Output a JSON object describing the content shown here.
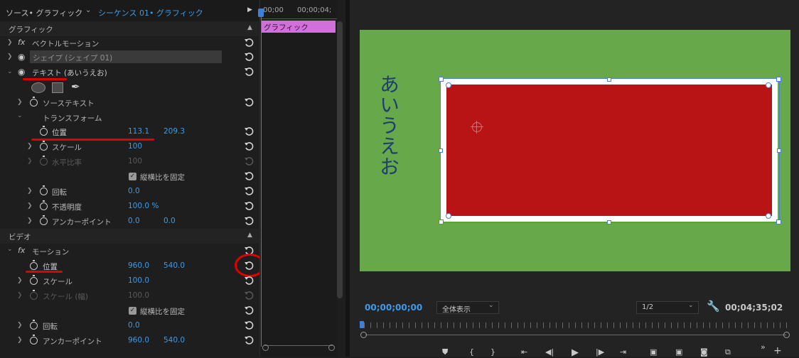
{
  "header": {
    "source_tab": "ソース• グラフィック",
    "sequence_tab": "シーケンス 01• グラフィック",
    "time_start": "00;00",
    "time_end": "00;00;04;"
  },
  "sections": {
    "graphics": "グラフィック",
    "video": "ビデオ"
  },
  "graphics": {
    "vector_motion": "ベクトルモーション",
    "shape_layer": "シェイプ (シェイプ 01)",
    "text_layer": "テキスト (あいうえお)",
    "source_text": "ソーステキスト",
    "transform": "トランスフォーム",
    "position_label": "位置",
    "position_x": "113.1",
    "position_y": "209.3",
    "scale_label": "スケール",
    "scale_value": "100",
    "scale_h_label": "水平比率",
    "scale_h_value": "100",
    "uniform_scale": "縦横比を固定",
    "rotation_label": "回転",
    "rotation_value": "0.0",
    "opacity_label": "不透明度",
    "opacity_value": "100.0 %",
    "anchor_label": "アンカーポイント",
    "anchor_x": "0.0",
    "anchor_y": "0.0"
  },
  "video": {
    "motion": "モーション",
    "position_label": "位置",
    "position_x": "960.0",
    "position_y": "540.0",
    "scale_label": "スケール",
    "scale_value": "100.0",
    "scale_w_label": "スケール (幅)",
    "scale_w_value": "100.0",
    "uniform_scale": "縦横比を固定",
    "rotation_label": "回転",
    "rotation_value": "0.0",
    "anchor_label": "アンカーポイント",
    "anchor_x": "960.0",
    "anchor_y": "540.0"
  },
  "timeline": {
    "clip_label": "グラフィック"
  },
  "preview": {
    "vertical_text": "あいうえお",
    "bg_color": "#67a84b",
    "rect_color": "#b81416",
    "text_color": "#1f3f6f"
  },
  "bottom": {
    "current_time": "00;00;00;00",
    "fit_select": "全体表示",
    "resolution_select": "1/2",
    "duration": "00;04;35;02"
  },
  "icons": {
    "marker": "marker-icon",
    "in": "mark-in-icon",
    "out": "mark-out-icon",
    "go_in": "go-to-in-icon",
    "step_back": "step-back-icon",
    "play": "play-icon",
    "step_fwd": "step-forward-icon",
    "go_out": "go-to-out-icon",
    "lift": "lift-icon",
    "extract": "extract-icon",
    "camera": "export-frame-icon",
    "compare": "compare-icon",
    "more": "more-icon",
    "add": "add-icon"
  }
}
